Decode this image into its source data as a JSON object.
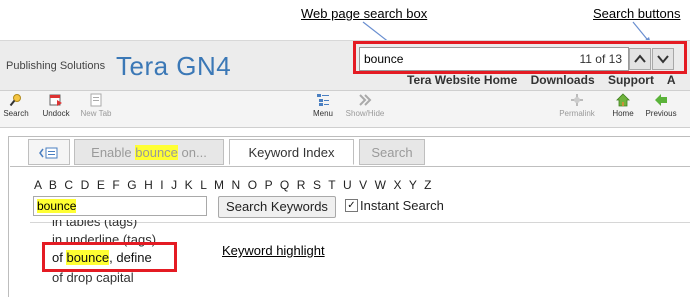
{
  "callouts": {
    "search_box": "Web page search box",
    "search_buttons": "Search buttons",
    "keyword_highlight": "Keyword highlight"
  },
  "header": {
    "brand_small": "Publishing Solutions",
    "brand_big": "Tera GN4",
    "search_value": "bounce",
    "search_count": "11 of 13",
    "links": [
      "Tera Website Home",
      "Downloads",
      "Support",
      "A"
    ]
  },
  "toolbar": {
    "items": [
      {
        "label": "Search",
        "icon": "search-icon"
      },
      {
        "label": "Undock",
        "icon": "undock-icon"
      },
      {
        "label": "New Tab",
        "icon": "new-tab-icon"
      },
      {
        "label": "Menu",
        "icon": "menu-icon"
      },
      {
        "label": "Show/Hide",
        "icon": "show-hide-icon"
      },
      {
        "label": "Permalink",
        "icon": "permalink-icon"
      },
      {
        "label": "Home",
        "icon": "home-icon"
      },
      {
        "label": "Previous",
        "icon": "previous-icon"
      }
    ]
  },
  "tabs": {
    "tab1_prefix": "Enable ",
    "tab1_highlight": "bounce",
    "tab1_suffix": " on...",
    "tab2": "Keyword Index",
    "tab3": "Search"
  },
  "keyword_index": {
    "letters": "A B C D E F G H I J K L M N O P Q R S T U V W X Y Z",
    "input_value": "bounce",
    "search_button": "Search Keywords",
    "instant_search": "Instant Search",
    "lines": [
      "in tables (tags)",
      "in underline (tags)",
      "of ",
      "bounce",
      ", define",
      "of drop capital"
    ]
  },
  "colors": {
    "accent_red": "#e41b23",
    "brand_blue": "#3b78b6",
    "highlight": "#ffff33"
  }
}
